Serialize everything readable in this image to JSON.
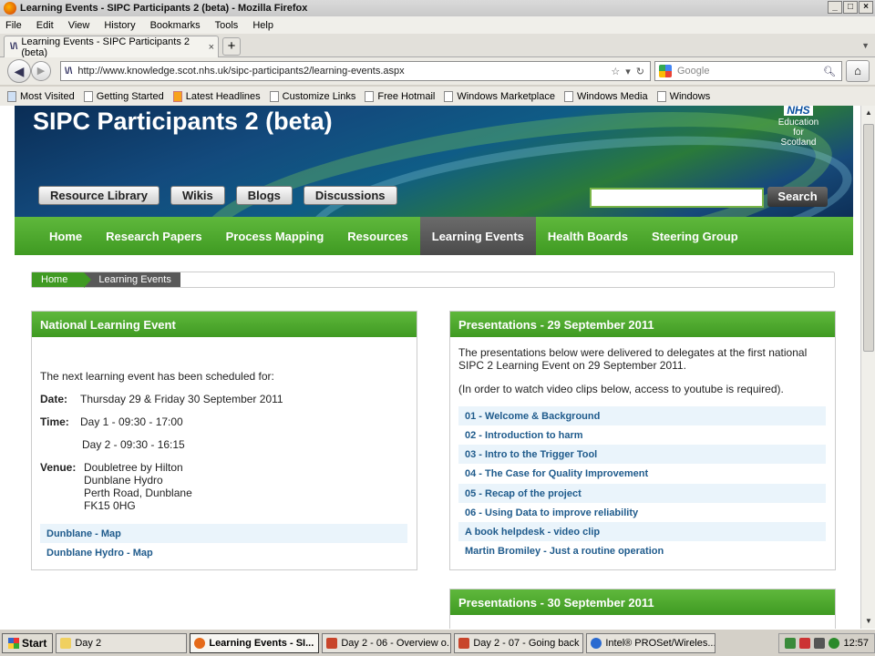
{
  "window": {
    "title": "Learning Events - SIPC Participants 2 (beta) - Mozilla Firefox"
  },
  "menu": [
    "File",
    "Edit",
    "View",
    "History",
    "Bookmarks",
    "Tools",
    "Help"
  ],
  "tab": {
    "title": "Learning Events - SIPC Participants 2 (beta)",
    "close": "×",
    "new": "+"
  },
  "url": "http://www.knowledge.scot.nhs.uk/sipc-participants2/learning-events.aspx",
  "search_placeholder": "Google",
  "bookmarks": [
    "Most Visited",
    "Getting Started",
    "Latest Headlines",
    "Customize Links",
    "Free Hotmail",
    "Windows Marketplace",
    "Windows Media",
    "Windows"
  ],
  "site": {
    "title": "SIPC Participants 2 (beta)",
    "nhs": {
      "mark": "NHS",
      "l1": "Education",
      "l2": "for",
      "l3": "Scotland"
    },
    "toplinks": [
      "Resource Library",
      "Wikis",
      "Blogs",
      "Discussions"
    ],
    "search_button": "Search",
    "nav": [
      "Home",
      "Research Papers",
      "Process Mapping",
      "Resources",
      "Learning Events",
      "Health Boards",
      "Steering Group"
    ],
    "breadcrumb": [
      "Home",
      "Learning Events"
    ]
  },
  "left": {
    "title": "National Learning Event",
    "intro": "The next learning event has been scheduled for:",
    "date_label": "Date:",
    "date": "Thursday 29 & Friday 30 September 2011",
    "time_label": "Time:",
    "time1": "Day 1 - 09:30 - 17:00",
    "time2": "Day 2 - 09:30 - 16:15",
    "venue_label": "Venue:",
    "venue": [
      "Doubletree by Hilton",
      "Dunblane Hydro",
      "Perth Road, Dunblane",
      "FK15 0HG"
    ],
    "links": [
      "Dunblane - Map",
      "Dunblane Hydro - Map"
    ]
  },
  "right": {
    "title": "Presentations - 29 September 2011",
    "p1": "The presentations below were delivered to delegates at the first national SIPC 2 Learning Event on 29 September 2011.",
    "p2": "(In order to watch video clips below, access to youtube is required).",
    "links": [
      "01 - Welcome & Background",
      "02 - Introduction to harm",
      "03 - Intro to the Trigger Tool",
      "04 - The Case for Quality Improvement",
      "05 - Recap of the project",
      "06 - Using Data to improve reliability",
      "A book helpdesk - video clip",
      "Martin Bromiley - Just a routine operation"
    ]
  },
  "right2": {
    "title": "Presentations - 30 September 2011"
  },
  "taskbar": {
    "start": "Start",
    "tasks": [
      "Day 2",
      "Learning Events - SI...",
      "Day 2 - 06 - Overview o...",
      "Day 2 - 07 - Going back ...",
      "Intel® PROSet/Wireles..."
    ],
    "clock": "12:57"
  }
}
